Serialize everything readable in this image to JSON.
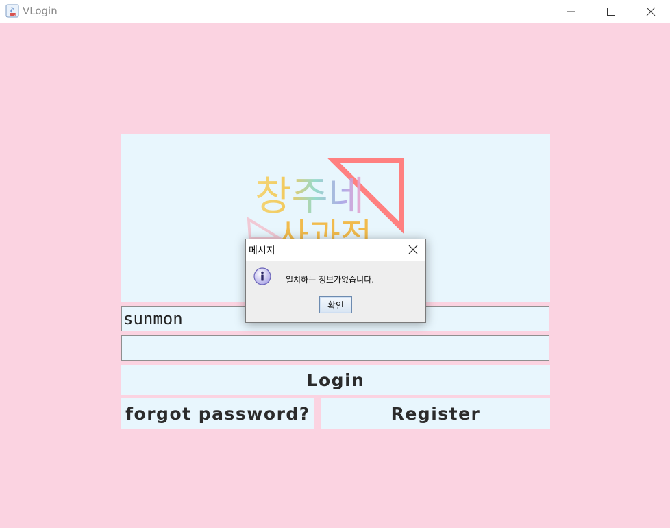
{
  "window": {
    "title": "VLogin",
    "controls": [
      "minimize",
      "maximize",
      "close"
    ]
  },
  "banner": {
    "logo_text_line1": "창주네",
    "logo_text_line2": "사과전"
  },
  "form": {
    "username_value": "sunmon",
    "password_value": "",
    "login_label": "Login",
    "forgot_label": "forgot password?",
    "register_label": "Register"
  },
  "dialog": {
    "title": "메시지",
    "message": "일치하는 정보가없습니다.",
    "ok_label": "확인",
    "icon": "info-icon"
  },
  "colors": {
    "background": "#fbd3e1",
    "panel": "#e8f6fd",
    "accent_triangle": "#ff8080"
  }
}
